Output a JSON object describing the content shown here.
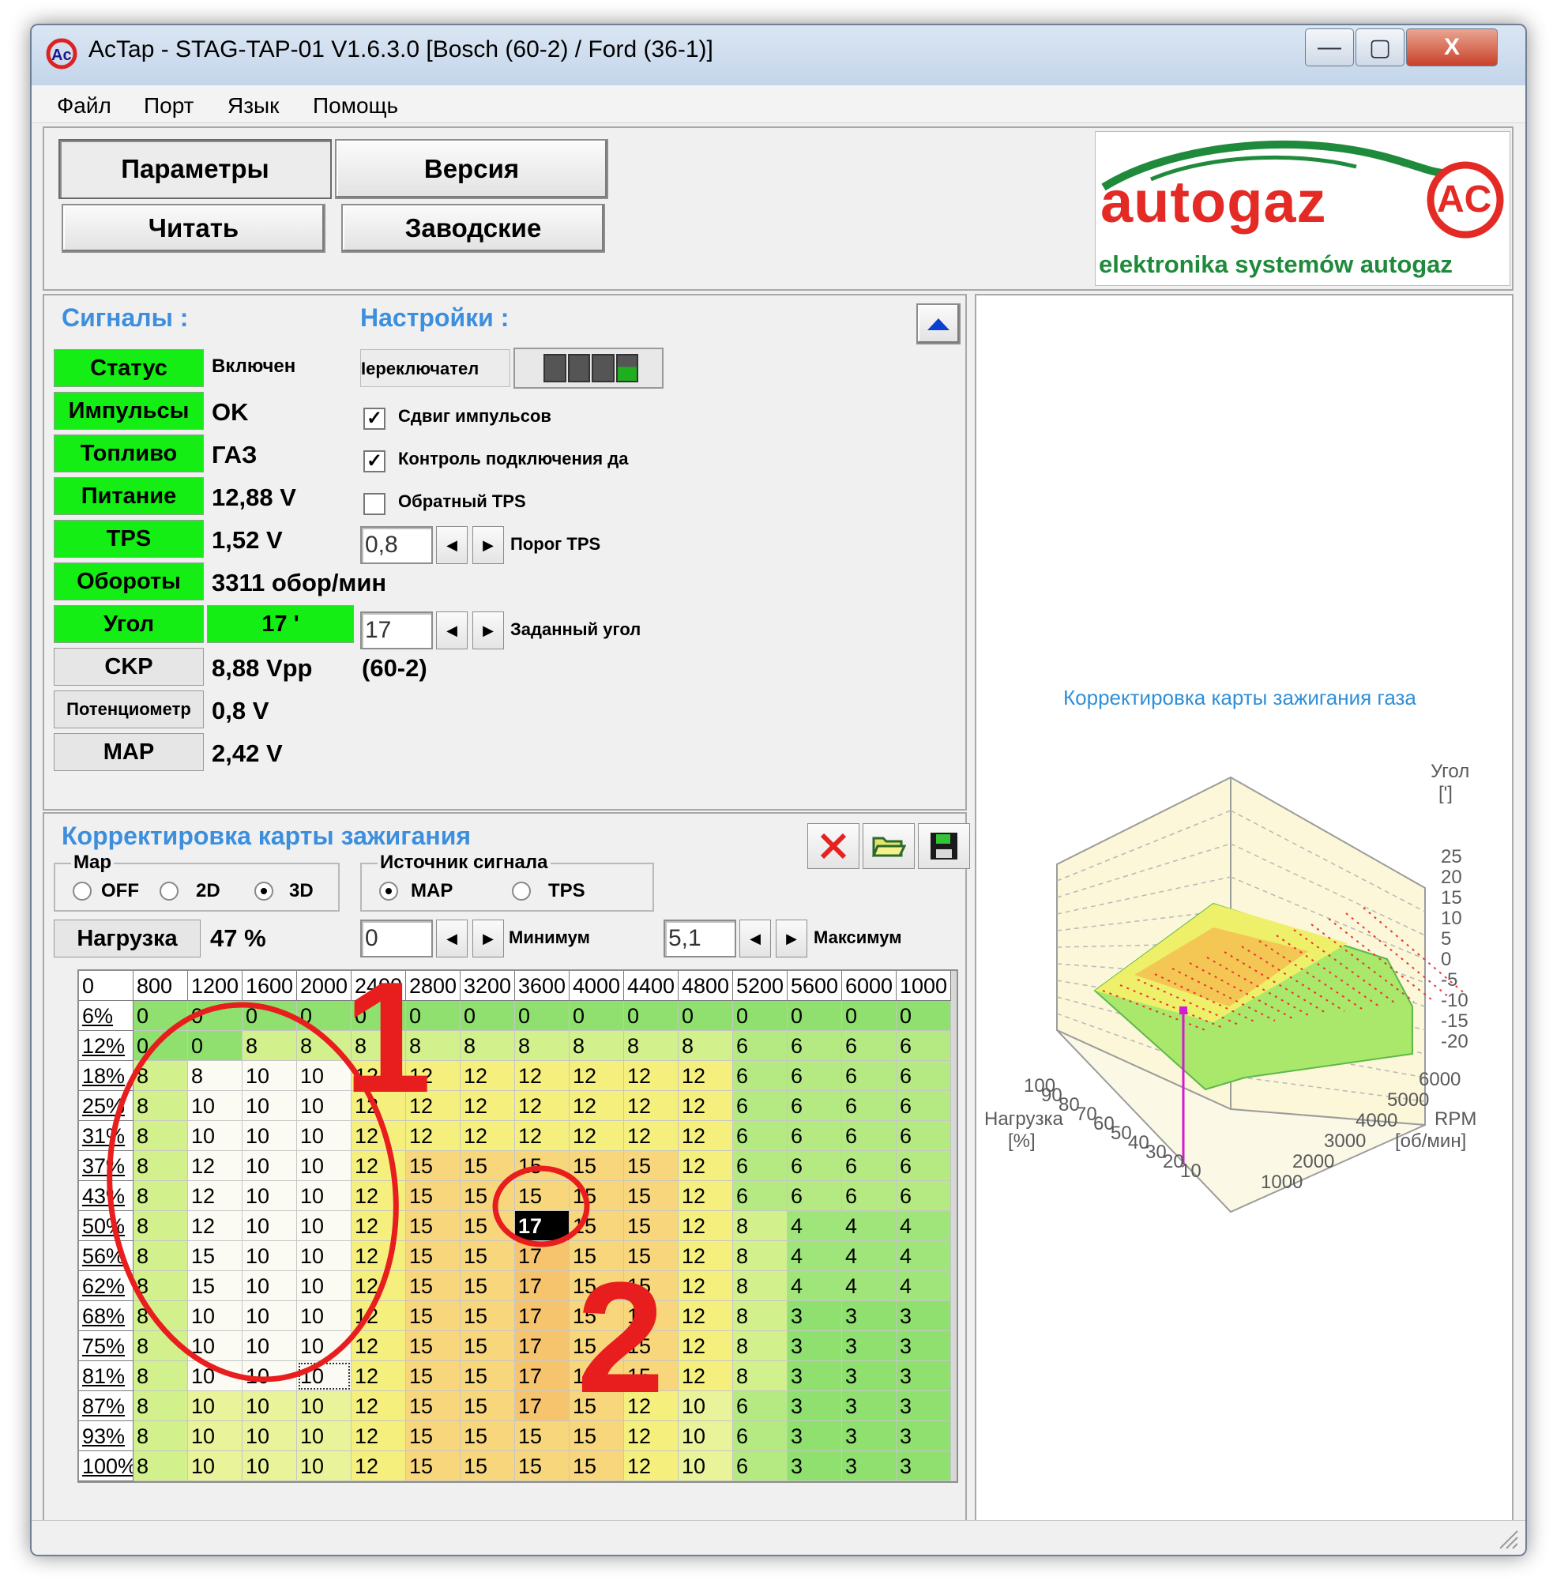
{
  "window": {
    "title": "AcTap  -  STAG-TAP-01 V1.6.3.0  [Bosch (60-2) / Ford (36-1)]",
    "minimize": "—",
    "maximize": "▢",
    "close": "X"
  },
  "menu": [
    "Файл",
    "Порт",
    "Язык",
    "Помощь"
  ],
  "toolbar": {
    "params": "Параметры",
    "version": "Версия",
    "read": "Читать",
    "factory": "Заводские"
  },
  "logo": {
    "brand": "autogaz",
    "mark": "AC",
    "tagline": "elektronika systemów autogaz"
  },
  "signals": {
    "header": "Сигналы :",
    "rows": [
      {
        "label": "Статус",
        "value": "Включен",
        "color": "#14ee14"
      },
      {
        "label": "Импульсы",
        "value": "OK",
        "color": "#14ee14"
      },
      {
        "label": "Топливо",
        "value": "ГАЗ",
        "color": "#14ee14"
      },
      {
        "label": "Питание",
        "value": "12,88 V",
        "color": "#14ee14"
      },
      {
        "label": "TPS",
        "value": "1,52 V",
        "color": "#14ee14"
      },
      {
        "label": "Обороты",
        "value": "3311 обор/мин",
        "color": "#14ee14"
      },
      {
        "label": "Угол",
        "value": "17 '",
        "color": "#14ee14"
      },
      {
        "label": "CKP",
        "value": "8,88 Vpp",
        "extra": "(60-2)",
        "color": "#e6e6e6"
      },
      {
        "label": "Потенциометр",
        "value": "0,8 V",
        "color": "#e6e6e6"
      },
      {
        "label": "MAP",
        "value": "2,42 V",
        "color": "#e6e6e6"
      }
    ]
  },
  "settings": {
    "header": "Настройки :",
    "switch_label": "Iереключател",
    "shift_label": "Сдвиг импульсов",
    "shift_checked": true,
    "conn_label": "Контроль подключения да",
    "conn_checked": true,
    "inverse_tps_label": "Обратный TPS",
    "inverse_tps_checked": false,
    "tps_threshold_value": "0,8",
    "tps_threshold_label": "Порог TPS",
    "target_angle_value": "17",
    "target_angle_label": "Заданный угол"
  },
  "map_section": {
    "header": "Корректировка карты зажигания",
    "map_group": "Map",
    "map_options": [
      "OFF",
      "2D",
      "3D"
    ],
    "map_selected": "3D",
    "source_group": "Источник сигнала",
    "source_options": [
      "MAP",
      "TPS"
    ],
    "source_selected": "MAP",
    "load_label": "Нагрузка",
    "load_value": "47 %",
    "min_value": "0",
    "min_label": "Минимум",
    "max_value": "5,1",
    "max_label": "Максимум"
  },
  "table": {
    "corner": "0",
    "columns": [
      "800",
      "1200",
      "1600",
      "2000",
      "2400",
      "2800",
      "3200",
      "3600",
      "4000",
      "4400",
      "4800",
      "5200",
      "5600",
      "6000",
      "1000"
    ],
    "rows": [
      {
        "load": "6%",
        "values": [
          0,
          0,
          0,
          0,
          0,
          0,
          0,
          0,
          0,
          0,
          0,
          0,
          0,
          0,
          0
        ]
      },
      {
        "load": "12%",
        "values": [
          0,
          0,
          8,
          8,
          8,
          8,
          8,
          8,
          8,
          8,
          8,
          6,
          6,
          6,
          6
        ]
      },
      {
        "load": "18%",
        "values": [
          8,
          8,
          10,
          10,
          12,
          12,
          12,
          12,
          12,
          12,
          12,
          6,
          6,
          6,
          6
        ]
      },
      {
        "load": "25%",
        "values": [
          8,
          10,
          10,
          10,
          12,
          12,
          12,
          12,
          12,
          12,
          12,
          6,
          6,
          6,
          6
        ]
      },
      {
        "load": "31%",
        "values": [
          8,
          10,
          10,
          10,
          12,
          12,
          12,
          12,
          12,
          12,
          12,
          6,
          6,
          6,
          6
        ]
      },
      {
        "load": "37%",
        "values": [
          8,
          12,
          10,
          10,
          12,
          15,
          15,
          15,
          15,
          15,
          12,
          6,
          6,
          6,
          6
        ]
      },
      {
        "load": "43%",
        "values": [
          8,
          12,
          10,
          10,
          12,
          15,
          15,
          15,
          15,
          15,
          12,
          6,
          6,
          6,
          6
        ]
      },
      {
        "load": "50%",
        "values": [
          8,
          12,
          10,
          10,
          12,
          15,
          15,
          17,
          15,
          15,
          12,
          8,
          4,
          4,
          4
        ]
      },
      {
        "load": "56%",
        "values": [
          8,
          15,
          10,
          10,
          12,
          15,
          15,
          17,
          15,
          15,
          12,
          8,
          4,
          4,
          4
        ]
      },
      {
        "load": "62%",
        "values": [
          8,
          15,
          10,
          10,
          12,
          15,
          15,
          17,
          15,
          15,
          12,
          8,
          4,
          4,
          4
        ]
      },
      {
        "load": "68%",
        "values": [
          8,
          10,
          10,
          10,
          12,
          15,
          15,
          17,
          15,
          15,
          12,
          8,
          3,
          3,
          3
        ]
      },
      {
        "load": "75%",
        "values": [
          8,
          10,
          10,
          10,
          12,
          15,
          15,
          17,
          15,
          15,
          12,
          8,
          3,
          3,
          3
        ]
      },
      {
        "load": "81%",
        "values": [
          8,
          10,
          10,
          10,
          12,
          15,
          15,
          17,
          15,
          15,
          12,
          8,
          3,
          3,
          3
        ]
      },
      {
        "load": "87%",
        "values": [
          8,
          10,
          10,
          10,
          12,
          15,
          15,
          17,
          15,
          12,
          10,
          6,
          3,
          3,
          3
        ]
      },
      {
        "load": "93%",
        "values": [
          8,
          10,
          10,
          10,
          12,
          15,
          15,
          15,
          15,
          12,
          10,
          6,
          3,
          3,
          3
        ]
      },
      {
        "load": "100%",
        "values": [
          8,
          10,
          10,
          10,
          12,
          15,
          15,
          15,
          15,
          12,
          10,
          6,
          3,
          3,
          3
        ]
      }
    ],
    "selected": {
      "row": 7,
      "col": 7
    },
    "focused": {
      "row": 12,
      "col": 3
    }
  },
  "annotations": {
    "label1": "1",
    "label2": "2",
    "color": "#e81e1e"
  },
  "chart3d": {
    "title": "Корректировка карты зажигания газа",
    "z_label": "Угол",
    "z_unit": "[']",
    "z_ticks": [
      "25",
      "20",
      "15",
      "10",
      "5",
      "0",
      "-5",
      "-10",
      "-15",
      "-20"
    ],
    "load_label": "Нагрузка",
    "load_unit": "[%]",
    "load_ticks": [
      "100",
      "90",
      "80",
      "70",
      "60",
      "50",
      "40",
      "30",
      "20",
      "10"
    ],
    "rpm_label": "RPM",
    "rpm_unit": "[об/мин]",
    "rpm_ticks": [
      "6000",
      "5000",
      "4000",
      "3000",
      "2000",
      "1000"
    ]
  }
}
